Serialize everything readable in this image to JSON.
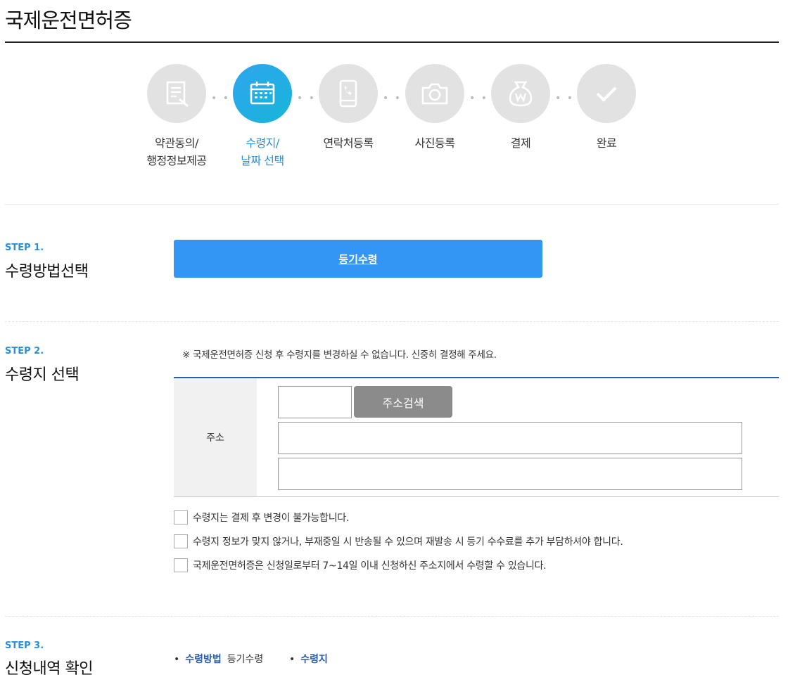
{
  "page": {
    "title": "국제운전면허증"
  },
  "stepper": {
    "steps": [
      {
        "label": "약관동의/\n행정정보제공",
        "icon": "document-pen-icon",
        "active": false
      },
      {
        "label": "수령지/\n날짜 선택",
        "icon": "calendar-icon",
        "active": true
      },
      {
        "label": "연락처등록",
        "icon": "phone-icon",
        "active": false
      },
      {
        "label": "사진등록",
        "icon": "camera-icon",
        "active": false
      },
      {
        "label": "결제",
        "icon": "money-bag-icon",
        "active": false
      },
      {
        "label": "완료",
        "icon": "check-icon",
        "active": false
      }
    ],
    "dots": "• •"
  },
  "step1": {
    "no": "STEP 1.",
    "name": "수령방법선택",
    "method_button": "등기수령"
  },
  "step2": {
    "no": "STEP 2.",
    "name": "수령지 선택",
    "notice": "※ 국제운전면허증 신청 후 수령지를 변경하실 수 없습니다. 신중히 결정해 주세요.",
    "address_label": "주소",
    "search_button": "주소검색",
    "postcode_value": "",
    "address1_value": "",
    "address2_value": "",
    "checks": [
      "수령지는 결제 후 변경이 불가능합니다.",
      "수령지 정보가 맞지 않거나, 부재중일 시 반송될 수 있으며 재발송 시 등기 수수료를 추가 부담하셔야 합니다.",
      "국제운전면허증은 신청일로부터 7~14일 이내 신청하신 주소지에서 수령할 수 있습니다."
    ]
  },
  "step3": {
    "no": "STEP 3.",
    "name": "신청내역 확인",
    "bullet": "•",
    "method_key": "수령방법",
    "method_value": "등기수령",
    "place_key": "수령지",
    "place_value": ""
  },
  "colors": {
    "accent": "#3396f5",
    "step_active": "#2b8fd8",
    "table_border": "#2b5ea8"
  }
}
